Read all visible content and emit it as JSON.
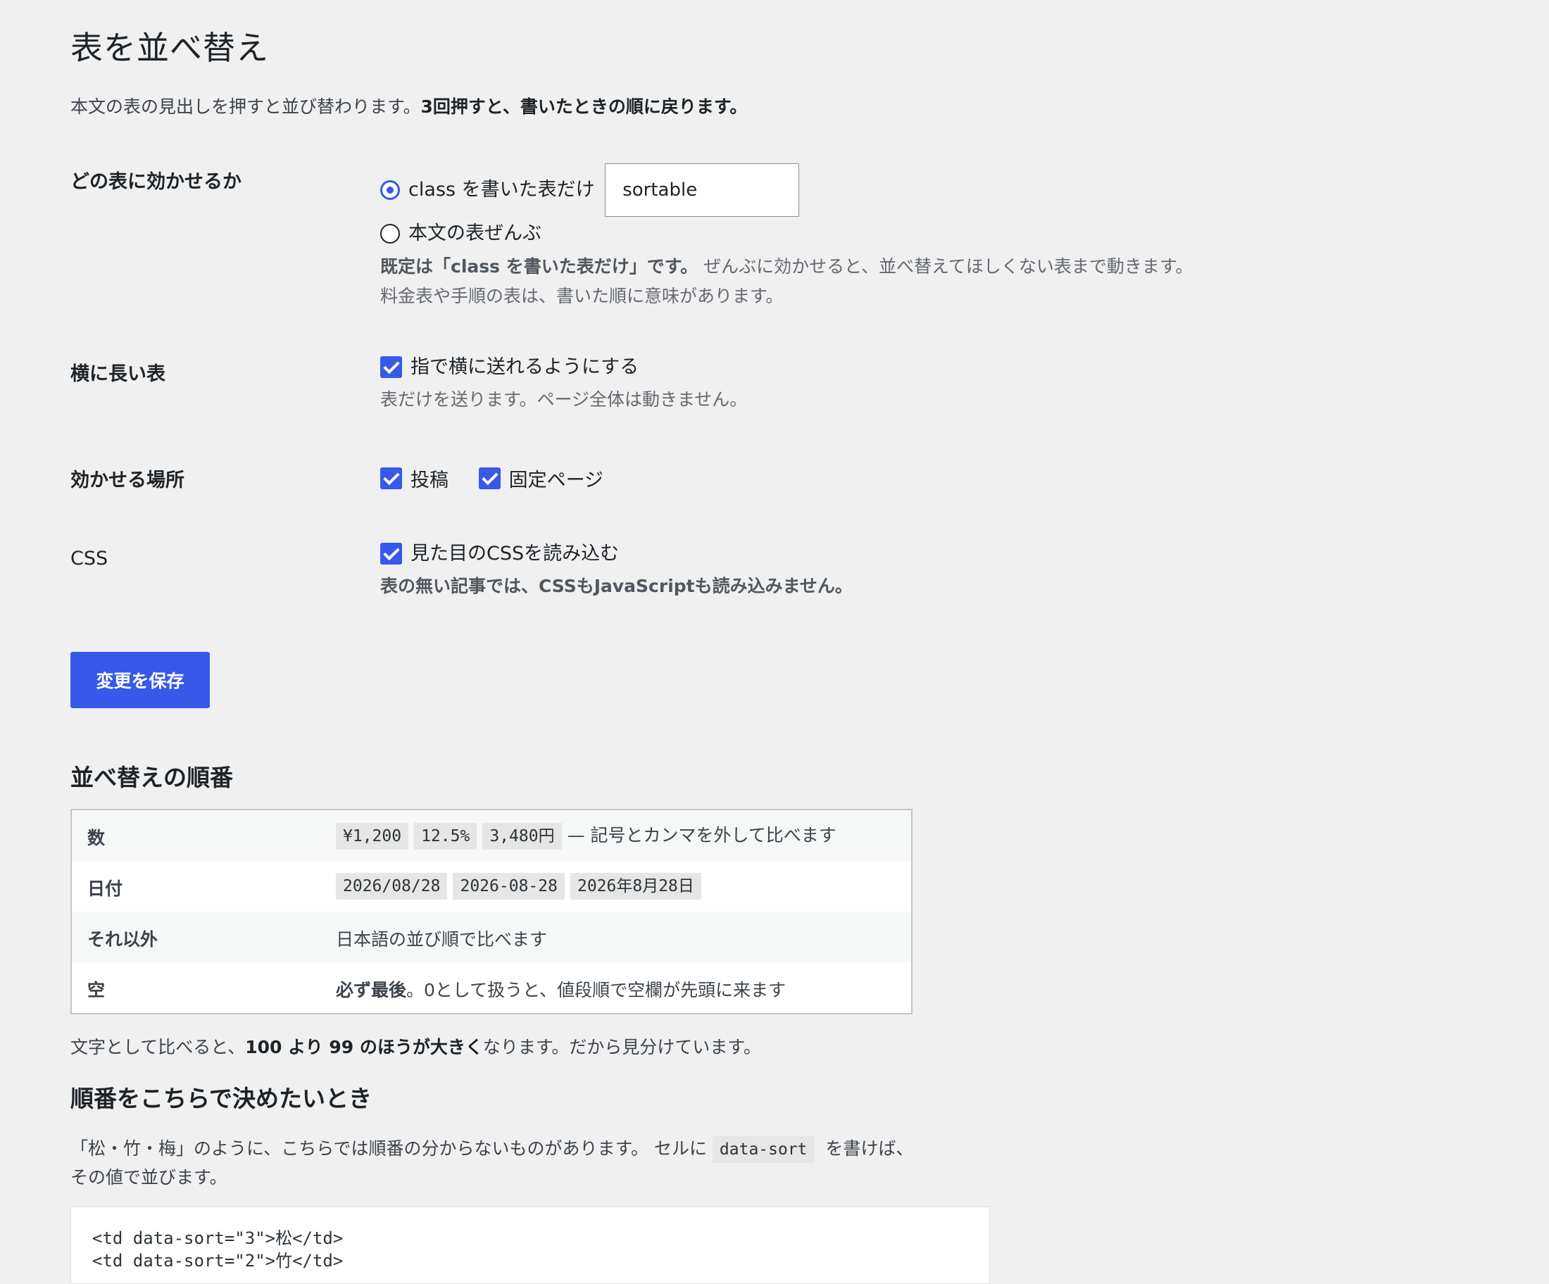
{
  "page": {
    "title": "表を並べ替え",
    "intro_text": "本文の表の見出しを押すと並び替わります。",
    "intro_bold": "3回押すと、書いたときの順に戻ります。"
  },
  "settings": {
    "target": {
      "label": "どの表に効かせるか",
      "option_class": "class を書いた表だけ",
      "class_value": "sortable",
      "option_all": "本文の表ぜんぶ",
      "desc_bold": "既定は「class を書いた表だけ」です。",
      "desc_text": " ぜんぶに効かせると、並べ替えてほしくない表まで動きます。",
      "desc_line2": "料金表や手順の表は、書いた順に意味があります。"
    },
    "wide": {
      "label": "横に長い表",
      "option": "指で横に送れるようにする",
      "desc": "表だけを送ります。ページ全体は動きません。"
    },
    "where": {
      "label": "効かせる場所",
      "option_posts": "投稿",
      "option_pages": "固定ページ"
    },
    "css": {
      "label": "CSS",
      "option": "見た目のCSSを読み込む",
      "desc_bold": "表の無い記事では、CSSもJavaScriptも読み込みません。"
    },
    "save_label": "変更を保存"
  },
  "order": {
    "heading": "並べ替えの順番",
    "rows": [
      {
        "key": "数",
        "chips": [
          "¥1,200",
          "12.5%",
          "3,480円"
        ],
        "text": "— 記号とカンマを外して比べます"
      },
      {
        "key": "日付",
        "chips": [
          "2026/08/28",
          "2026-08-28",
          "2026年8月28日"
        ],
        "text": ""
      },
      {
        "key": "それ以外",
        "text": "日本語の並び順で比べます"
      },
      {
        "key": "空",
        "bold": "必ず最後",
        "text": "。0として扱うと、値段順で空欄が先頭に来ます"
      }
    ],
    "note_pre": "文字として比べると、",
    "note_bold": "100 より 99 のほうが大きく",
    "note_post": "なります。だから見分けています。"
  },
  "custom": {
    "heading": "順番をこちらで決めたいとき",
    "text1": "「松・竹・梅」のように、こちらでは順番の分からないものがあります。 セルに ",
    "code": "data-sort",
    "text2": " を書けば、",
    "text3": "その値で並びます。",
    "code_line1": "<td data-sort=\"3\">松</td>",
    "code_line2": "<td data-sort=\"2\">竹</td>"
  }
}
